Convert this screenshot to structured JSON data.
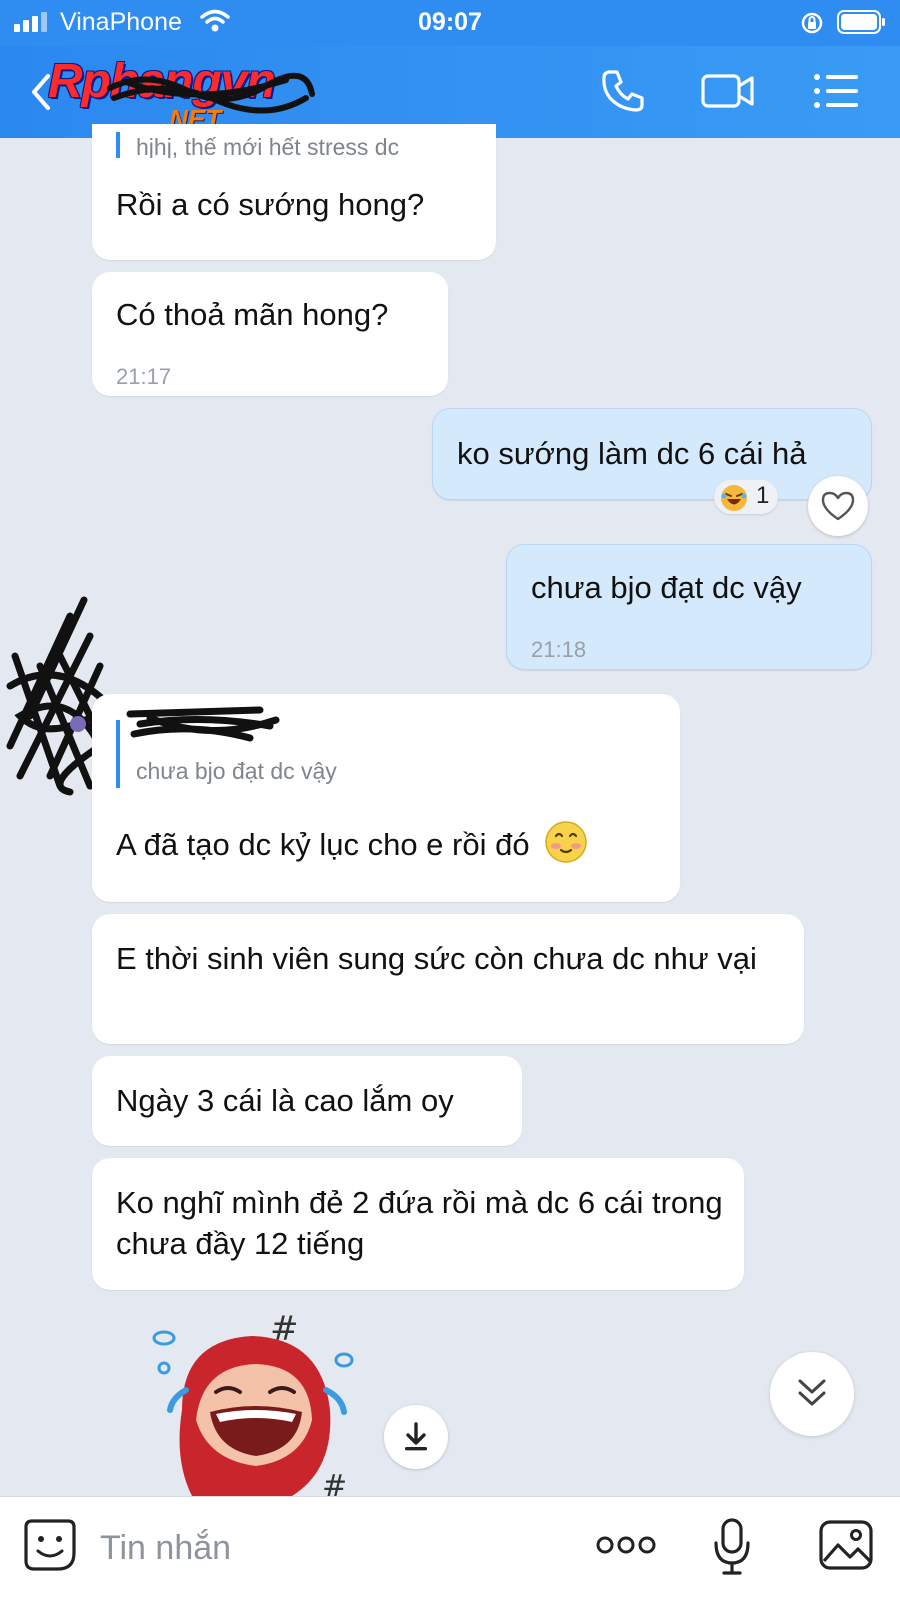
{
  "status_bar": {
    "carrier": "VinaPhone",
    "time": "09:07"
  },
  "header": {
    "logo_text": "Rphangvn",
    "logo_sub": ".NET",
    "icons": [
      "back-arrow-icon",
      "phone-icon",
      "video-camera-icon",
      "list-menu-icon"
    ]
  },
  "messages": [
    {
      "side": "left",
      "quote": "hjhj, thế mới hết stress dc",
      "text": "Rồi a có sướng hong?",
      "time": ""
    },
    {
      "side": "left",
      "text": "Có thoả mãn hong?",
      "time": "21:17"
    },
    {
      "side": "right",
      "text": "ko sướng làm dc 6 cái hả",
      "time": ""
    },
    {
      "side": "right",
      "text": "chưa bjo đạt dc vậy",
      "time": "21:18"
    },
    {
      "side": "left",
      "quote": "chưa bjo đạt dc vậy",
      "text": "A đã tạo dc kỷ lục cho e rồi đó",
      "emoji": "blushing-smile-emoji",
      "time": ""
    },
    {
      "side": "left",
      "text": "E thời sinh viên sung sức còn chưa dc như vại",
      "time": ""
    },
    {
      "side": "left",
      "text": "Ngày 3 cái là cao lắm oy",
      "time": ""
    },
    {
      "side": "left",
      "text": "Ko nghĩ mình đẻ 2 đứa rồi mà dc 6 cái trong chưa đầy 12 tiếng",
      "time": ""
    }
  ],
  "reaction": {
    "emoji": "laughing-face-emoji",
    "count": "1"
  },
  "sticker": {
    "name": "crying-laughing-red-hood-sticker",
    "mark": "#"
  },
  "composer": {
    "placeholder": "Tin nhắn",
    "value": ""
  },
  "colors": {
    "header": "#2f8cf0",
    "chat_background": "#e4e8f0",
    "my_bubble": "#d4e9fb",
    "other_bubble": "#ffffff",
    "quote_bar": "#2f8cf0"
  }
}
